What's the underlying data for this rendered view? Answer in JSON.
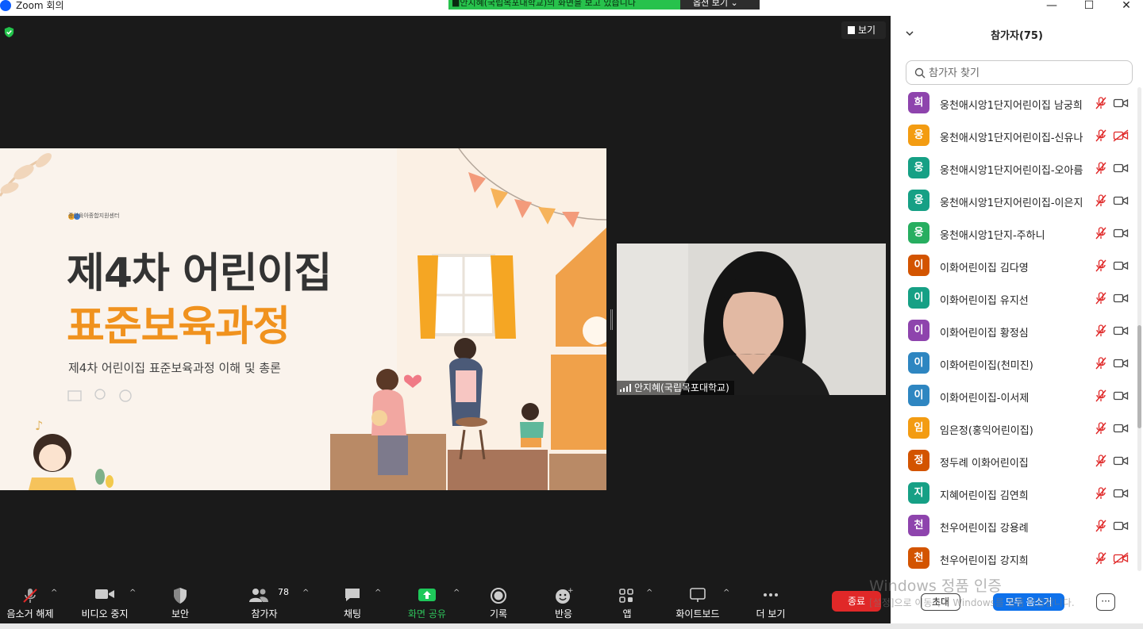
{
  "window": {
    "title": "Zoom 회의",
    "minimize": "—",
    "maximize": "☐",
    "close": "✕"
  },
  "share_banner": {
    "text": "■안지혜(국립목포대학교)의 화면을 보고 있습니다",
    "view_options": "옵션 보기 ⌄"
  },
  "meeting": {
    "view_label": "보기"
  },
  "slide": {
    "org": "중앙육아종합지원센터",
    "title_line1": "제4차 어린이집",
    "title_line2": "표준보육과정",
    "subtitle": "제4차 어린이집 표준보육과정 이해 및 총론"
  },
  "video": {
    "name": "안지혜(국립목포대학교)"
  },
  "toolbar": {
    "mute": "음소거 해제",
    "video": "비디오 중지",
    "security": "보안",
    "participants": "참가자",
    "participants_count": "78",
    "chat": "채팅",
    "share": "화면 공유",
    "record": "기록",
    "reactions": "반응",
    "apps": "앱",
    "whiteboard": "화이트보드",
    "more": "더 보기",
    "end": "종료"
  },
  "panel": {
    "title": "참가자(75)",
    "search_placeholder": "참가자 찾기",
    "invite": "초대",
    "mute_all": "모두 음소거",
    "more": "···",
    "participants": [
      {
        "initial": "희",
        "name": "웅천애시앙1단지어린이집 남궁희",
        "color": "#8e44ad",
        "cam_off": false
      },
      {
        "initial": "웅",
        "name": "웅천애시앙1단지어린이집-신유나",
        "color": "#f39c12",
        "cam_off": true
      },
      {
        "initial": "웅",
        "name": "웅천애시앙1단지어린이집-오아름",
        "color": "#16a085",
        "cam_off": false
      },
      {
        "initial": "웅",
        "name": "웅천애시앙1단지어린이집-이은지",
        "color": "#16a085",
        "cam_off": false
      },
      {
        "initial": "웅",
        "name": "웅천애시앙1단지-주하니",
        "color": "#27ae60",
        "cam_off": false
      },
      {
        "initial": "이",
        "name": "이화어린이집 김다영",
        "color": "#d35400",
        "cam_off": false
      },
      {
        "initial": "이",
        "name": "이화어린이집 유지선",
        "color": "#16a085",
        "cam_off": false
      },
      {
        "initial": "이",
        "name": "이화어린이집 황정심",
        "color": "#8e44ad",
        "cam_off": false
      },
      {
        "initial": "이",
        "name": "이화어린이집(천미진)",
        "color": "#2e86c1",
        "cam_off": false
      },
      {
        "initial": "이",
        "name": "이화어린이집-이서제",
        "color": "#2e86c1",
        "cam_off": false
      },
      {
        "initial": "임",
        "name": "임은정(홍익어린이집)",
        "color": "#f39c12",
        "cam_off": false
      },
      {
        "initial": "정",
        "name": "정두례 이화어린이집",
        "color": "#d35400",
        "cam_off": false
      },
      {
        "initial": "지",
        "name": "지혜어린이집 김연희",
        "color": "#16a085",
        "cam_off": false
      },
      {
        "initial": "천",
        "name": "천우어린이집 강용례",
        "color": "#8e44ad",
        "cam_off": false
      },
      {
        "initial": "천",
        "name": "천우어린이집 강지희",
        "color": "#d35400",
        "cam_off": true
      }
    ]
  },
  "watermark": {
    "line1": "Windows 정품 인증",
    "line2": "[설정]으로 이동하여 Windows를 정품 인증합니다."
  },
  "colors": {
    "accent": "#0e71eb",
    "share_green": "#27c24c",
    "end_red": "#e02828",
    "slide_orange": "#f0921e"
  }
}
